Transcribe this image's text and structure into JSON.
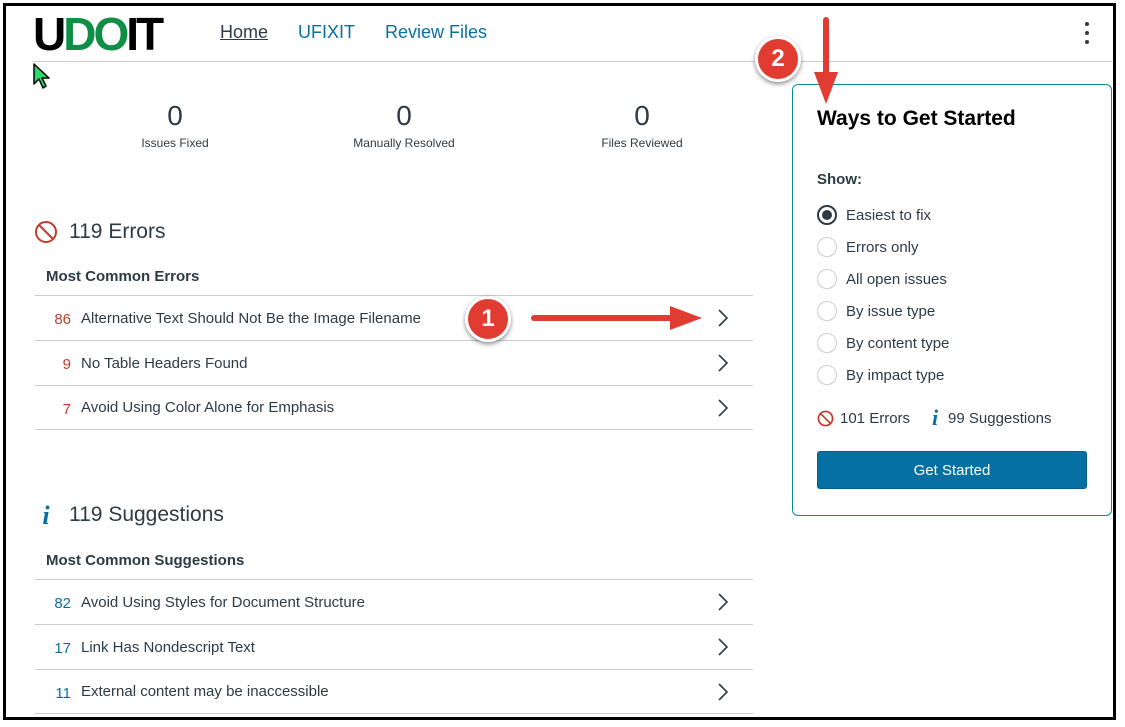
{
  "logo": {
    "u": "U",
    "do": "DO",
    "it": "IT"
  },
  "nav": {
    "home": "Home",
    "ufixit": "UFIXIT",
    "review_files": "Review Files"
  },
  "stats": [
    {
      "value": "0",
      "label": "Issues Fixed"
    },
    {
      "value": "0",
      "label": "Manually Resolved"
    },
    {
      "value": "0",
      "label": "Files Reviewed"
    }
  ],
  "errors": {
    "title": "119 Errors",
    "subhead": "Most Common Errors",
    "items": [
      {
        "count": "86",
        "label": "Alternative Text Should Not Be the Image Filename"
      },
      {
        "count": "9",
        "label": "No Table Headers Found"
      },
      {
        "count": "7",
        "label": "Avoid Using Color Alone for Emphasis"
      }
    ]
  },
  "suggestions": {
    "title": "119 Suggestions",
    "subhead": "Most Common Suggestions",
    "items": [
      {
        "count": "82",
        "label": "Avoid Using Styles for Document Structure"
      },
      {
        "count": "17",
        "label": "Link Has Nondescript Text"
      },
      {
        "count": "11",
        "label": "External content may be inaccessible"
      }
    ]
  },
  "panel": {
    "title": "Ways to Get Started",
    "show_label": "Show:",
    "options": [
      {
        "label": "Easiest to fix",
        "selected": true
      },
      {
        "label": "Errors only",
        "selected": false
      },
      {
        "label": "All open issues",
        "selected": false
      },
      {
        "label": "By issue type",
        "selected": false
      },
      {
        "label": "By content type",
        "selected": false
      },
      {
        "label": "By impact type",
        "selected": false
      }
    ],
    "errors_summary": "101 Errors",
    "suggestions_summary": "99 Suggestions",
    "button": "Get Started"
  },
  "annotations": {
    "badge1": "1",
    "badge2": "2"
  },
  "colors": {
    "error": "#c23c2d",
    "info": "#0770a3",
    "brand_green": "#0f8f45",
    "annotation_red": "#e03c31"
  }
}
